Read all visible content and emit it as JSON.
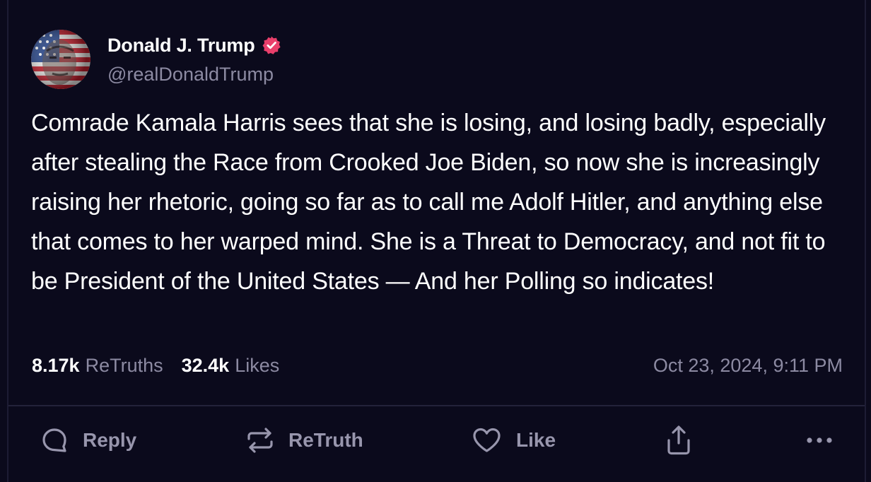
{
  "colors": {
    "background": "#0b0a1c",
    "text_primary": "#ffffff",
    "text_secondary": "#8c8aa2",
    "action_gray": "#9896ad",
    "verified_badge": "#e93f6b"
  },
  "author": {
    "display_name": "Donald J. Trump",
    "handle": "@realDonaldTrump",
    "verified_icon": "verified-badge-icon",
    "avatar_icon": "avatar"
  },
  "post": {
    "text": "Comrade Kamala Harris sees that she is losing, and losing badly, especially after stealing the Race from Crooked Joe Biden, so now she is increasingly raising her rhetoric, going so far as to call me Adolf Hitler, and anything else that comes to her warped mind. She is a Threat to Democracy, and not fit to be President of the United States — And her Polling so indicates!"
  },
  "stats": {
    "retruths_count": "8.17k",
    "retruths_label": "ReTruths",
    "likes_count": "32.4k",
    "likes_label": "Likes",
    "timestamp": "Oct 23, 2024, 9:11 PM"
  },
  "actions": {
    "reply": {
      "label": "Reply",
      "icon": "reply-icon"
    },
    "retruth": {
      "label": "ReTruth",
      "icon": "retruth-icon"
    },
    "like": {
      "label": "Like",
      "icon": "heart-icon"
    },
    "share": {
      "icon": "share-icon"
    },
    "more": {
      "icon": "more-icon"
    }
  }
}
